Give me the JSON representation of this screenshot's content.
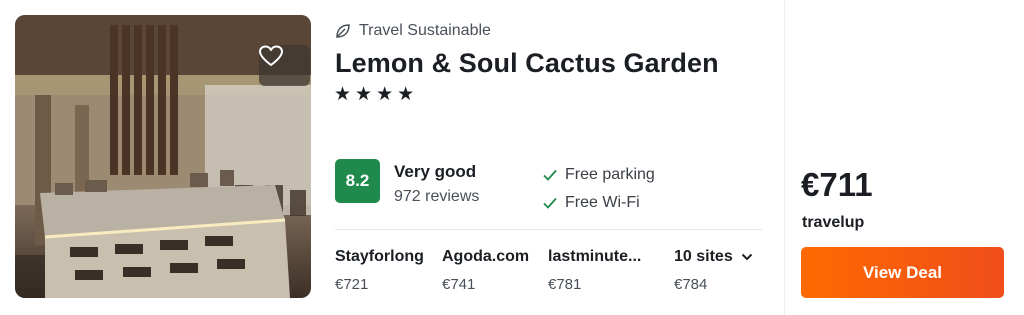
{
  "hotel": {
    "sustainability_label": "Travel Sustainable",
    "name": "Lemon & Soul Cactus Garden",
    "stars_display": "★★★★",
    "star_count": 4
  },
  "rating": {
    "score": "8.2",
    "label": "Very good",
    "reviews": "972 reviews",
    "badge_color": "#1f8a4c"
  },
  "amenities": [
    {
      "label": "Free parking",
      "icon": "check-icon"
    },
    {
      "label": "Free Wi-Fi",
      "icon": "check-icon"
    }
  ],
  "sites": [
    {
      "name": "Stayforlong",
      "price": "€721"
    },
    {
      "name": "Agoda.com",
      "price": "€741"
    },
    {
      "name": "lastminute...",
      "price": "€781"
    }
  ],
  "more_sites": {
    "label": "10 sites",
    "price": "€784",
    "icon": "chevron-down-icon"
  },
  "deal": {
    "price": "€711",
    "provider": "travelup",
    "button_label": "View Deal",
    "button_color": "#ff6a00"
  },
  "photo": {
    "favorite_icon": "heart-icon"
  }
}
